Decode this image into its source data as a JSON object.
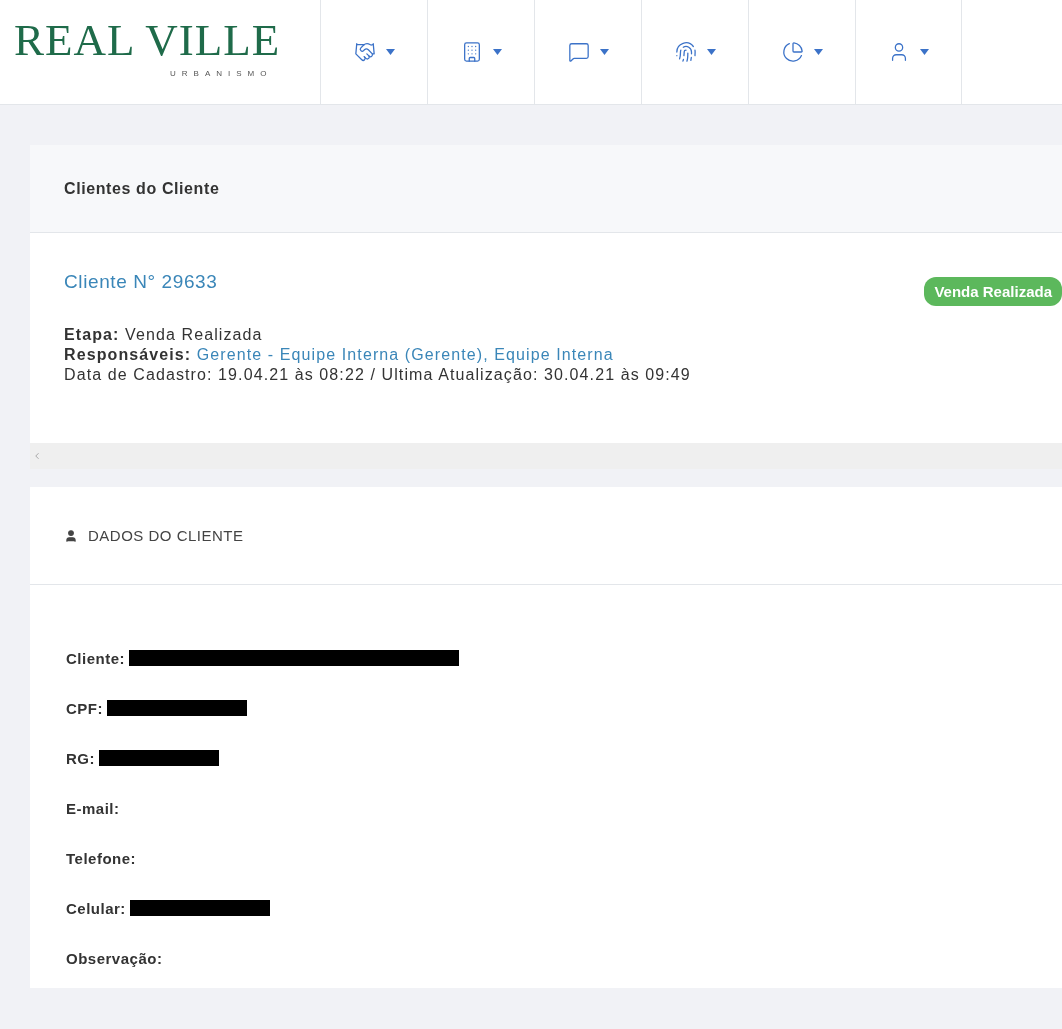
{
  "logo": {
    "name": "REAL VILLE",
    "tagline": "URBANISMO"
  },
  "nav": [
    {
      "kind": "handshake"
    },
    {
      "kind": "building"
    },
    {
      "kind": "message"
    },
    {
      "kind": "fingerprint"
    },
    {
      "kind": "chart"
    },
    {
      "kind": "user"
    }
  ],
  "client_card": {
    "title": "Clientes do Cliente",
    "client_number": "Cliente N° 29633",
    "status_badge": "Venda Realizada",
    "stage": {
      "label": "Etapa:",
      "value": "Venda Realizada"
    },
    "responsibles": {
      "label": "Responsáveis:",
      "value": "Gerente - Equipe Interna (Gerente), Equipe Interna"
    },
    "dates": "Data de Cadastro: 19.04.21 às 08:22 / Ultima Atualização: 30.04.21 às 09:49"
  },
  "data_card": {
    "title": "DADOS DO CLIENTE",
    "fields": [
      {
        "label": "Cliente:",
        "redacted": true
      },
      {
        "label": "CPF:",
        "redacted": true
      },
      {
        "label": "RG:",
        "redacted": true
      },
      {
        "label": "E-mail:",
        "redacted": false
      },
      {
        "label": "Telefone:",
        "redacted": false
      },
      {
        "label": "Celular:",
        "redacted": true
      },
      {
        "label": "Observação:",
        "redacted": false
      }
    ]
  }
}
